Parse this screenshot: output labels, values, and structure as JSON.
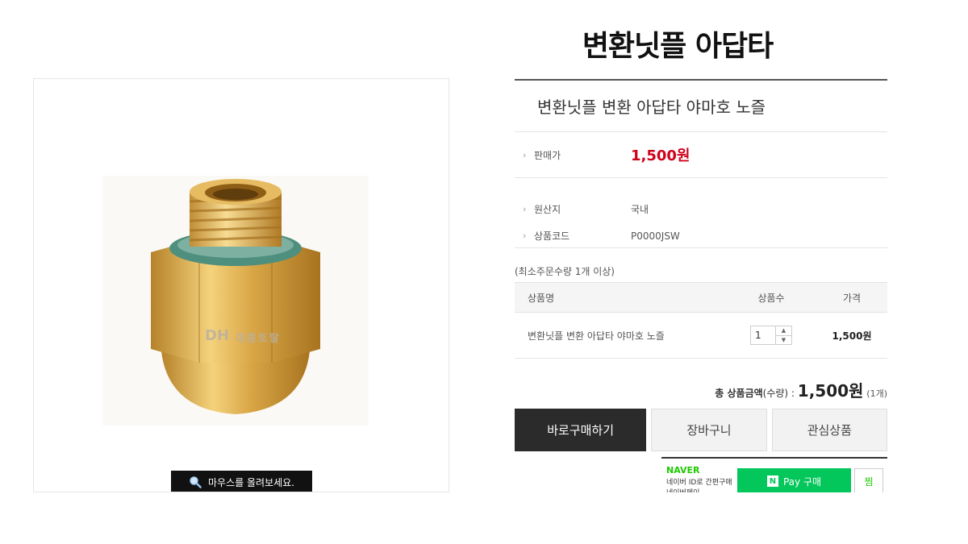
{
  "page": {
    "heading": "변환닛플 아답타"
  },
  "image_panel": {
    "watermark_logo": "DH",
    "watermark_text": "대흥토탈",
    "zoom_hint": "마우스를 올려보세요.",
    "zoom_icon": "magnifier-icon"
  },
  "product": {
    "name": "변환닛플 변환 아답타 야마호 노즐",
    "price_label": "판매가",
    "price": "1,500원",
    "origin_label": "원산지",
    "origin": "국내",
    "code_label": "상품코드",
    "code": "P0000JSW",
    "min_order": "(최소주문수량 1개 이상)"
  },
  "order_table": {
    "headers": [
      "상품명",
      "상품수",
      "가격"
    ],
    "rows": [
      {
        "name": "변환닛플 변환 아답타 야마호 노즐",
        "qty": "1",
        "price": "1,500원"
      }
    ]
  },
  "total": {
    "label": "총 상품금액",
    "qty_label": "(수량) :",
    "amount": "1,500원",
    "count": "(1개)"
  },
  "buttons": {
    "buy": "바로구매하기",
    "cart": "장바구니",
    "wish": "관심상품"
  },
  "npay": {
    "brand": "NAVER",
    "desc": "네이버 ID로 간편구매 네이버페이",
    "n_logo": "N",
    "button": "Pay 구매",
    "jjim": "찜"
  },
  "colors": {
    "price": "#d0021b",
    "buy_button": "#2b2b2b",
    "npay_green": "#03c75a"
  }
}
